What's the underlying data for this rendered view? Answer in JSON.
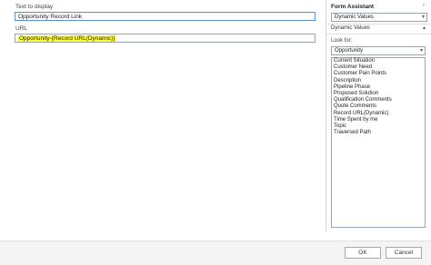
{
  "form": {
    "text_label": "Text to display",
    "text_value": "Opportunity Record Link",
    "url_label": "URL",
    "url_value": "Opportunity-{Record URL(Dynamic)}"
  },
  "assistant": {
    "title": "Form Assistant",
    "type_select": "Dynamic Values",
    "section_header": "Dynamic Values",
    "look_for_label": "Look for:",
    "look_for_value": "Opportunity",
    "fields": [
      "Current Situation",
      "Customer Need",
      "Customer Pain Points",
      "Description",
      "Pipeline Phase",
      "Proposed Solution",
      "Qualification Comments",
      "Quote Comments",
      "Record URL(Dynamic)",
      "Time Spent by me",
      "Topic",
      "Traversed Path"
    ]
  },
  "footer": {
    "ok_label": "OK",
    "cancel_label": "Cancel"
  },
  "colors": {
    "highlight": "#ffff33",
    "focus_border": "#5a8fd6"
  }
}
